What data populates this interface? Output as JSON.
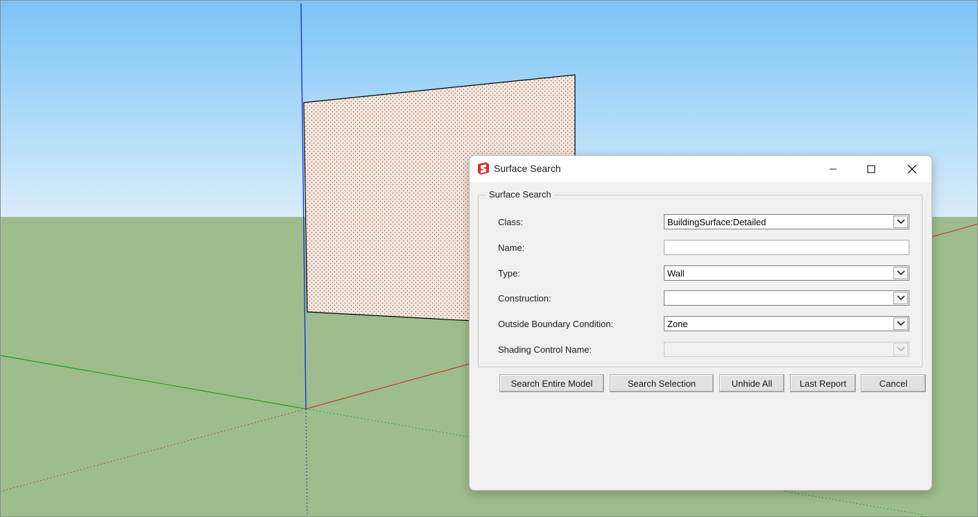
{
  "window": {
    "title": "Surface Search",
    "app_icon": "sketchup-icon",
    "controls": [
      "minimize-icon",
      "maximize-icon",
      "close-icon"
    ]
  },
  "group": {
    "title": "Surface Search"
  },
  "fields": {
    "class": {
      "label": "Class:",
      "value": "BuildingSurface:Detailed"
    },
    "name": {
      "label": "Name:",
      "value": ""
    },
    "type": {
      "label": "Type:",
      "value": "Wall"
    },
    "construction": {
      "label": "Construction:",
      "value": ""
    },
    "outside_boundary": {
      "label": "Outside Boundary Condition:",
      "value": "Zone"
    },
    "shading_control": {
      "label": "Shading Control Name:",
      "value": "",
      "disabled": true
    }
  },
  "buttons": {
    "search_entire_model": "Search Entire Model",
    "search_selection": "Search Selection",
    "unhide_all": "Unhide All",
    "last_report": "Last Report",
    "cancel": "Cancel"
  },
  "colors": {
    "sky_top": "#7cc4f6",
    "sky_bottom": "#d6ecfb",
    "ground": "#9ebd8d",
    "face": "#f6e4d4",
    "axis_red": "#c0392b",
    "axis_green": "#1aa01a",
    "axis_blue": "#1a2fd6",
    "sketchup_red": "#d9302c"
  }
}
